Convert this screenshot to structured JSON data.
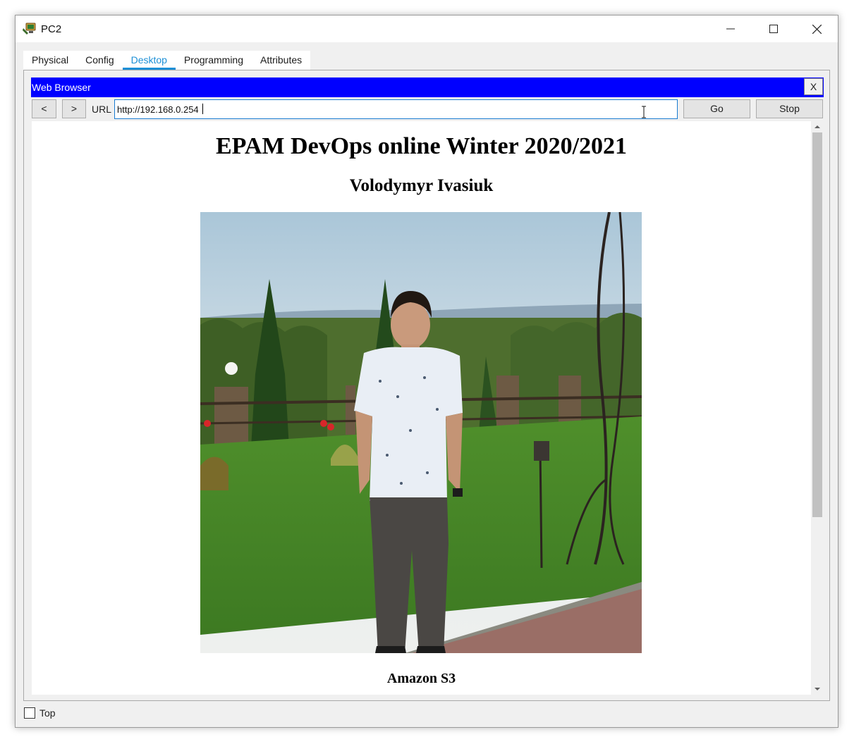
{
  "window": {
    "title": "PC2",
    "icon": "pc-app-icon",
    "controls": [
      "minimize-icon",
      "maximize-icon",
      "close-icon"
    ]
  },
  "tabs": [
    {
      "label": "Physical",
      "active": false
    },
    {
      "label": "Config",
      "active": false
    },
    {
      "label": "Desktop",
      "active": true
    },
    {
      "label": "Programming",
      "active": false
    },
    {
      "label": "Attributes",
      "active": false
    }
  ],
  "browser": {
    "title": "Web Browser",
    "close_label": "X",
    "back_label": "<",
    "forward_label": ">",
    "url_label": "URL",
    "url_value": "http://192.168.0.254",
    "go_label": "Go",
    "stop_label": "Stop",
    "title_bar_color": "#0000ff"
  },
  "page": {
    "heading": "EPAM DevOps online Winter 2020/2021",
    "subheading": "Volodymyr Ivasiuk",
    "image": "portrait-photo",
    "caption": "Amazon S3"
  },
  "footer": {
    "top_checkbox_label": "Top",
    "top_checked": false
  },
  "colors": {
    "accent": "#1c8fd6"
  }
}
